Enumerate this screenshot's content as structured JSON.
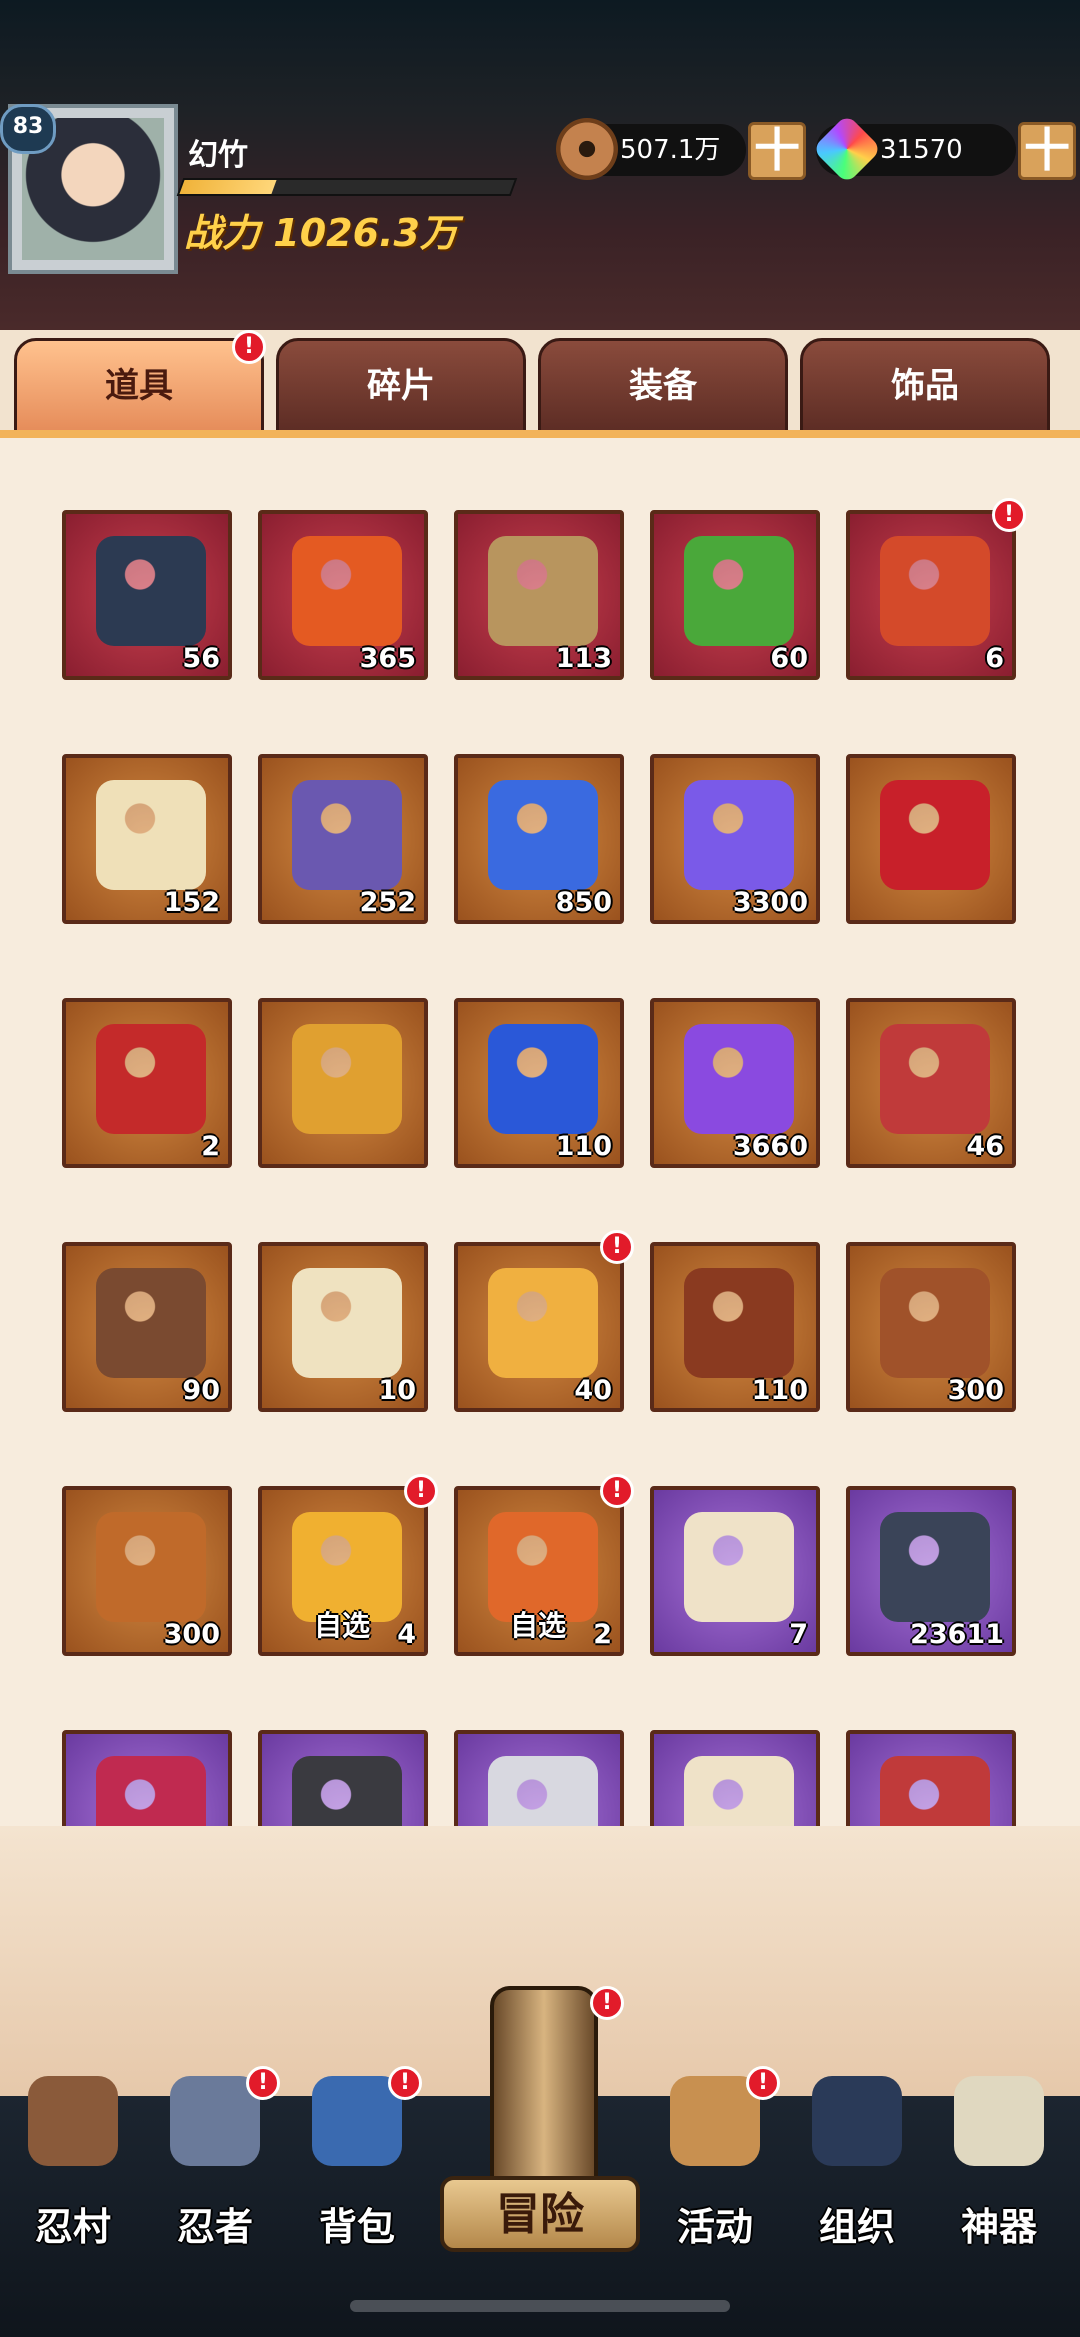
{
  "player": {
    "level": "83",
    "name": "幻竹",
    "exp_fraction": 0.28,
    "power_label": "战力",
    "power_value": "1026.3万"
  },
  "resources": {
    "copper": {
      "icon": "copper-coin-icon",
      "value": "507.1万"
    },
    "gem": {
      "icon": "rainbow-gem-icon",
      "value": "31570"
    },
    "plus": "十"
  },
  "tabs": [
    {
      "label": "道具",
      "active": true,
      "badge": "!"
    },
    {
      "label": "碎片",
      "active": false
    },
    {
      "label": "装备",
      "active": false
    },
    {
      "label": "饰品",
      "active": false
    }
  ],
  "items": [
    {
      "icon": "scroll-bundle-icon",
      "count": "56",
      "rarity": "red",
      "color": "#2c3a52"
    },
    {
      "icon": "flame-feather-icon",
      "count": "365",
      "rarity": "red",
      "color": "#e45a22"
    },
    {
      "icon": "wooden-stick-icon",
      "count": "113",
      "rarity": "red",
      "color": "#b8955e"
    },
    {
      "icon": "green-amulet-icon",
      "count": "60",
      "rarity": "red",
      "color": "#4aa83a"
    },
    {
      "icon": "gift-box-icon",
      "count": "6",
      "rarity": "red",
      "color": "#d44a2a",
      "badge": "!"
    },
    {
      "icon": "ninja-scroll-icon",
      "count": "152",
      "rarity": "orange",
      "color": "#efe0b8"
    },
    {
      "icon": "purple-banner-icon",
      "count": "252",
      "rarity": "orange",
      "color": "#6a58b0"
    },
    {
      "icon": "blue-orb-icon",
      "count": "850",
      "rarity": "orange",
      "color": "#3a6ae0"
    },
    {
      "icon": "purple-orb-icon",
      "count": "3300",
      "rarity": "orange",
      "color": "#7a5ae8"
    },
    {
      "icon": "red-stone-icon",
      "count": "",
      "rarity": "orange",
      "color": "#c8202a"
    },
    {
      "icon": "red-eye-stone-icon",
      "count": "2",
      "rarity": "orange",
      "color": "#c42a2a"
    },
    {
      "icon": "gold-stone-icon",
      "count": "",
      "rarity": "orange",
      "color": "#e0a030"
    },
    {
      "icon": "blue-crescent-icon",
      "count": "110",
      "rarity": "orange",
      "color": "#2a58d8"
    },
    {
      "icon": "purple-crystal-icon",
      "count": "3660",
      "rarity": "orange",
      "color": "#8a4ae0"
    },
    {
      "icon": "fortune-ticket-icon",
      "count": "46",
      "rarity": "orange",
      "color": "#c03a3a"
    },
    {
      "icon": "bronze-key-icon",
      "count": "90",
      "rarity": "orange",
      "color": "#7a4a30"
    },
    {
      "icon": "paper-talisman-icon",
      "count": "10",
      "rarity": "orange",
      "color": "#efe2c0"
    },
    {
      "icon": "cardboard-box-icon",
      "count": "40",
      "rarity": "orange",
      "color": "#f0b040",
      "badge": "!"
    },
    {
      "icon": "kunai-whirl-icon",
      "count": "110",
      "rarity": "orange",
      "color": "#8a3a20"
    },
    {
      "icon": "rope-whirl-icon",
      "count": "300",
      "rarity": "orange",
      "color": "#a0522a"
    },
    {
      "icon": "sake-jar-icon",
      "count": "300",
      "rarity": "orange",
      "color": "#c06a2a"
    },
    {
      "icon": "gold-chest-icon",
      "count": "4",
      "rarity": "orange",
      "color": "#f0b030",
      "tag": "自选",
      "badge": "!"
    },
    {
      "icon": "red-chest-icon",
      "count": "2",
      "rarity": "orange",
      "color": "#e0682a",
      "tag": "自选",
      "badge": "!"
    },
    {
      "icon": "blue-scroll-icon",
      "count": "7",
      "rarity": "purple",
      "color": "#efe2c8"
    },
    {
      "icon": "skill-book-icon",
      "count": "23611",
      "rarity": "purple",
      "color": "#3a4458"
    },
    {
      "icon": "potion-bottle-icon",
      "count": "",
      "rarity": "purple",
      "color": "#c02a50"
    },
    {
      "icon": "black-ore-icon",
      "count": "",
      "rarity": "purple",
      "color": "#3a3a40"
    },
    {
      "icon": "eyeball-icon",
      "count": "",
      "rarity": "purple",
      "color": "#d8d8e0"
    },
    {
      "icon": "paper-stack-icon",
      "count": "",
      "rarity": "purple",
      "color": "#efe2c8"
    },
    {
      "icon": "fortune-ticket-icon",
      "count": "",
      "rarity": "purple",
      "color": "#c03a3a"
    }
  ],
  "nav": [
    {
      "label": "忍村",
      "icon": "village-gate-icon",
      "color": "#8a5a3a"
    },
    {
      "label": "忍者",
      "icon": "ninja-head-icon",
      "color": "#6a7a9a",
      "badge": "!"
    },
    {
      "label": "背包",
      "icon": "backpack-icon",
      "color": "#3a6ab0",
      "badge": "!"
    },
    {
      "label": "活动",
      "icon": "drum-icon",
      "color": "#c89050",
      "badge": "!"
    },
    {
      "label": "组织",
      "icon": "team-icon",
      "color": "#2a3a58"
    },
    {
      "label": "神器",
      "icon": "artifact-scroll-icon",
      "color": "#e0d8c0"
    }
  ],
  "adventure": {
    "label": "冒险",
    "badge": "!"
  }
}
